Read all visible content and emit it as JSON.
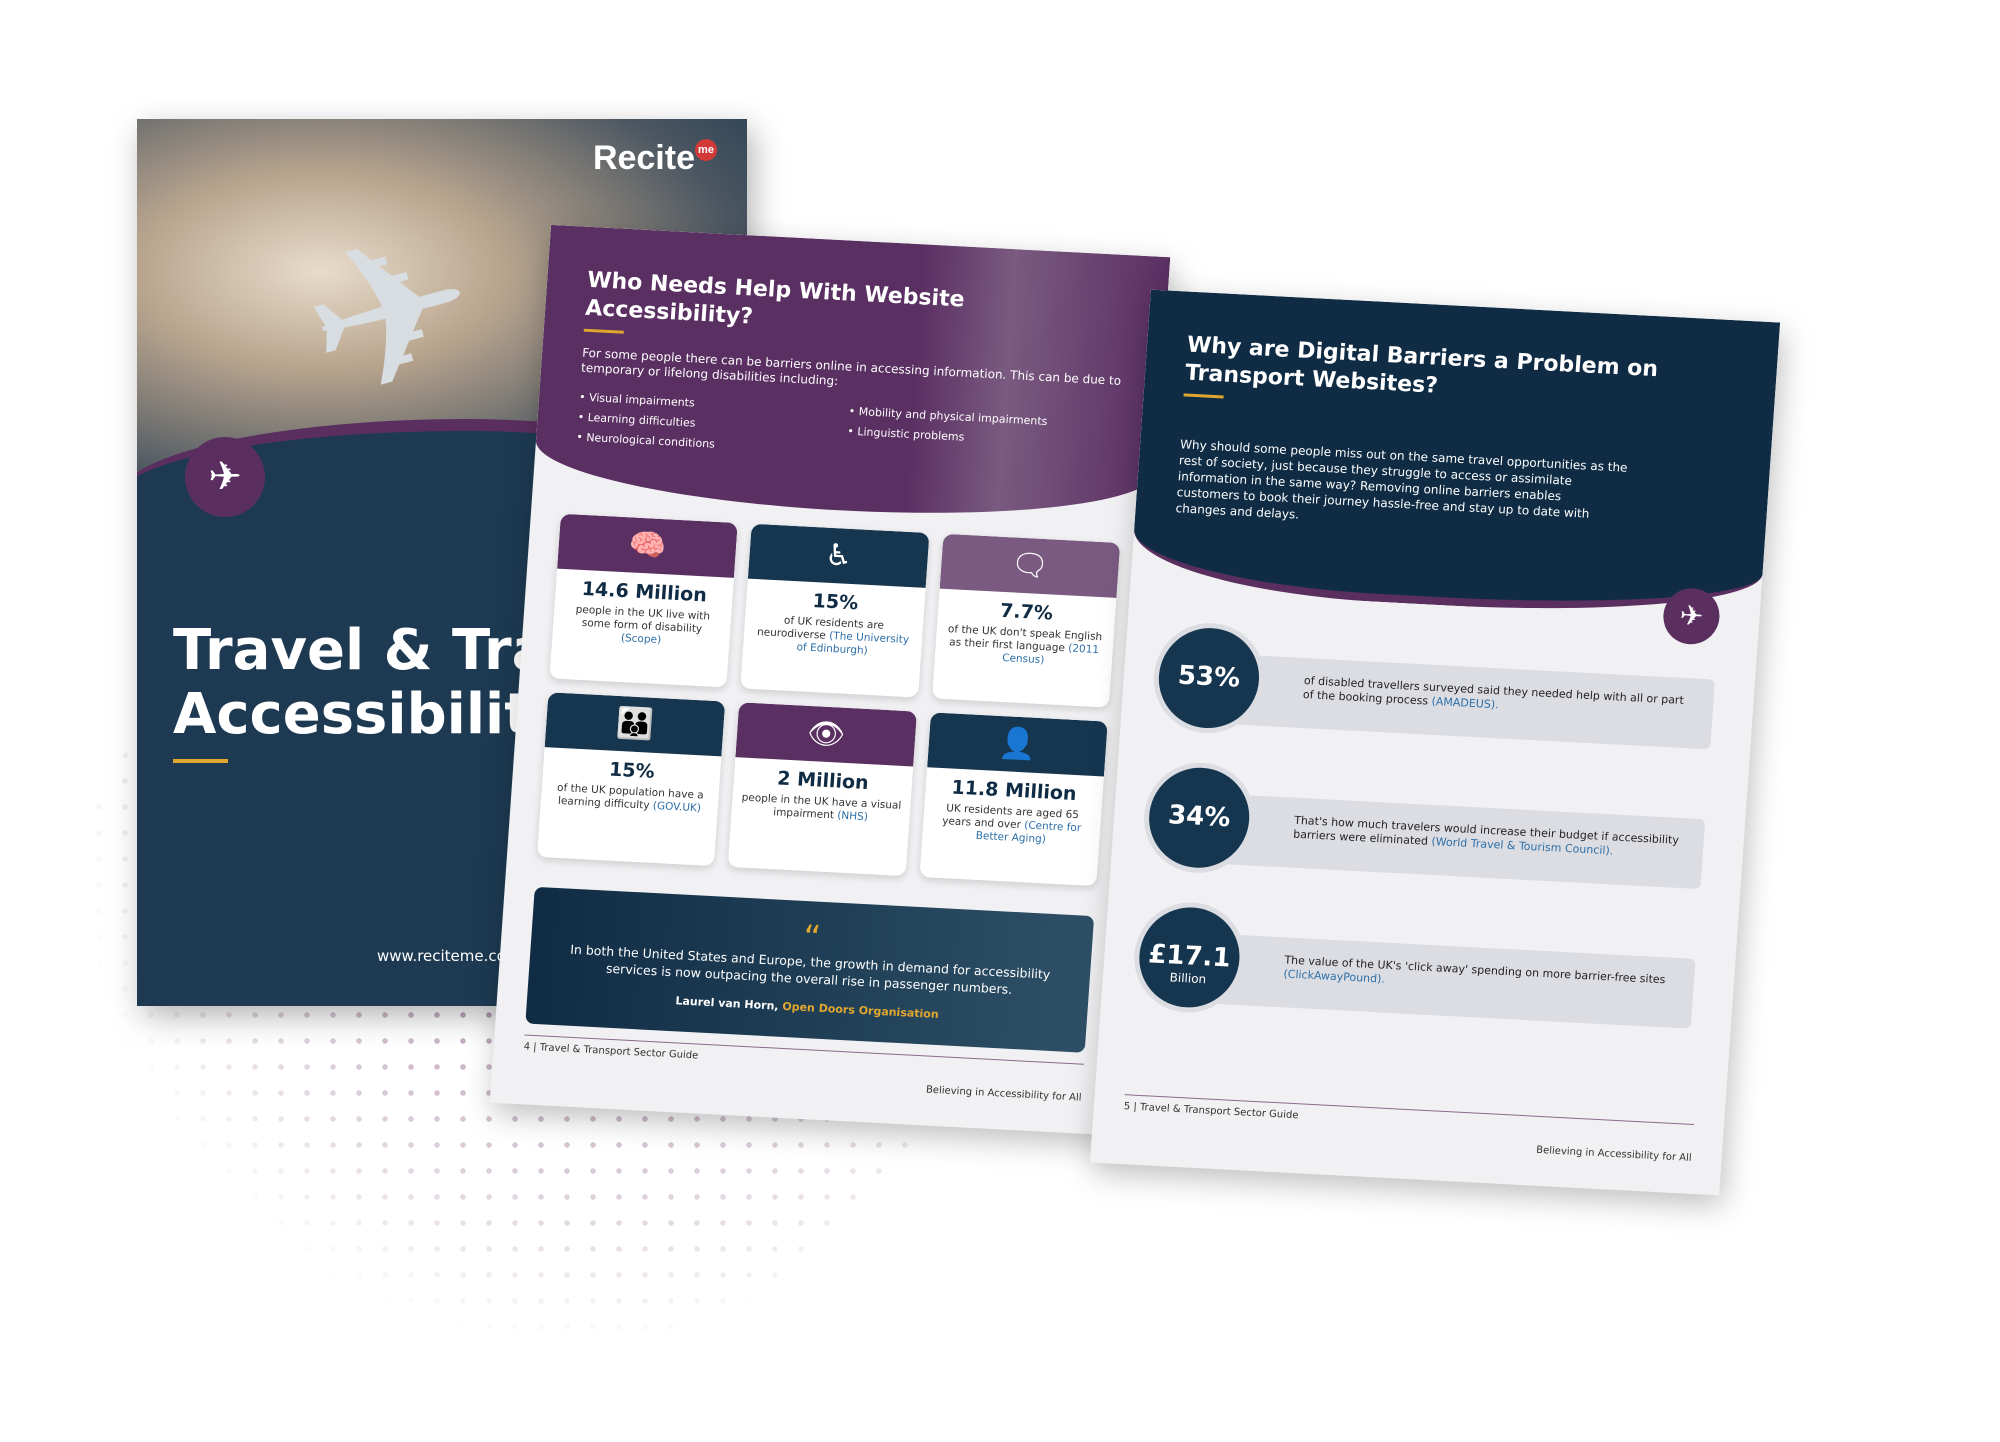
{
  "cover": {
    "logo": "Recite",
    "logo_badge": "me",
    "title_line1": "Travel & Tran",
    "title_line2": "Accessibility",
    "url": "www.reciteme.co",
    "icon": "airplane-icon"
  },
  "left_page": {
    "title": "Who Needs Help With Website Accessibility?",
    "intro": "For some people there can be barriers online in accessing information. This can be due to temporary or lifelong disabilities including:",
    "bullets": [
      "• Visual impairments",
      "• Mobility and physical impairments",
      "• Learning difficulties",
      "• Linguistic problems",
      "• Neurological conditions",
      ""
    ],
    "cards": [
      {
        "icon": "brain-icon",
        "glyph": "🧠",
        "value": "14.6 Million",
        "text": "people in the UK live with some form of disability",
        "source": "(Scope)",
        "color": "#5a2f62"
      },
      {
        "icon": "wheelchair-icon",
        "glyph": "♿",
        "value": "15%",
        "text": "of UK residents are neurodiverse",
        "source": "(The University of Edinburgh)",
        "color": "#163650"
      },
      {
        "icon": "language-icon",
        "glyph": "🗨",
        "value": "7.7%",
        "text": "of the UK don't speak English as their first language",
        "source": "(2011 Census)",
        "color": "#7a5a80"
      },
      {
        "icon": "people-icon",
        "glyph": "👪",
        "value": "15%",
        "text": "of the UK population have a learning difficulty",
        "source": "(GOV.UK)",
        "color": "#163650"
      },
      {
        "icon": "eye-slash-icon",
        "glyph": "👁",
        "value": "2 Million",
        "text": "people in the UK have a visual impairment",
        "source": "(NHS)",
        "color": "#5a2f62"
      },
      {
        "icon": "elderly-person-icon",
        "glyph": "👤",
        "value": "11.8 Million",
        "text": "UK residents are aged 65 years and over",
        "source": "(Centre for Better Aging)",
        "color": "#163650"
      }
    ],
    "quote": {
      "mark": "“",
      "text": "In both the United States and Europe, the growth in demand for accessibility services is now outpacing the overall rise in passenger numbers.",
      "author": "Laurel van Horn, ",
      "org": "Open Doors Organisation"
    },
    "footer_left": "4  |  Travel & Transport Sector Guide",
    "footer_right": "Believing in Accessibility for All"
  },
  "right_page": {
    "title": "Why are Digital Barriers a Problem on Transport Websites?",
    "intro": "Why should some people miss out on the same travel opportunities as the rest of society, just because they struggle to access or assimilate information in the same way? Removing online barriers enables customers to book their journey hassle-free and stay up to date with changes and delays.",
    "stats": [
      {
        "value": "53%",
        "unit": "",
        "text": "of disabled travellers surveyed said they needed help with all or part of the booking process ",
        "source": "(AMADEUS)."
      },
      {
        "value": "34%",
        "unit": "",
        "text": "That's how much travelers would increase their budget if accessibility barriers were eliminated ",
        "source": "(World Travel & Tourism Council)."
      },
      {
        "value": "£17.1",
        "unit": "Billion",
        "text": "The value of the UK's 'click away' spending on more barrier-free sites ",
        "source": "(ClickAwayPound)."
      }
    ],
    "footer_left": "5  |  Travel & Transport Sector Guide",
    "footer_right": "Believing in Accessibility for All"
  },
  "colors": {
    "purple": "#5a2f62",
    "navy": "#102c44",
    "gold": "#e0a72e",
    "link": "#2d6fa8"
  }
}
